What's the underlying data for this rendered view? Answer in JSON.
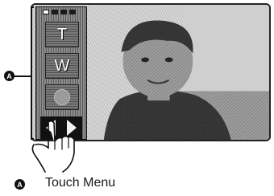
{
  "touch_menu": {
    "zoom_tele_label": "T",
    "zoom_wide_label": "W",
    "page_dots": 4,
    "active_dot": 0
  },
  "callout": {
    "marker": "A"
  },
  "legend": {
    "marker": "A",
    "label": "Touch Menu"
  }
}
